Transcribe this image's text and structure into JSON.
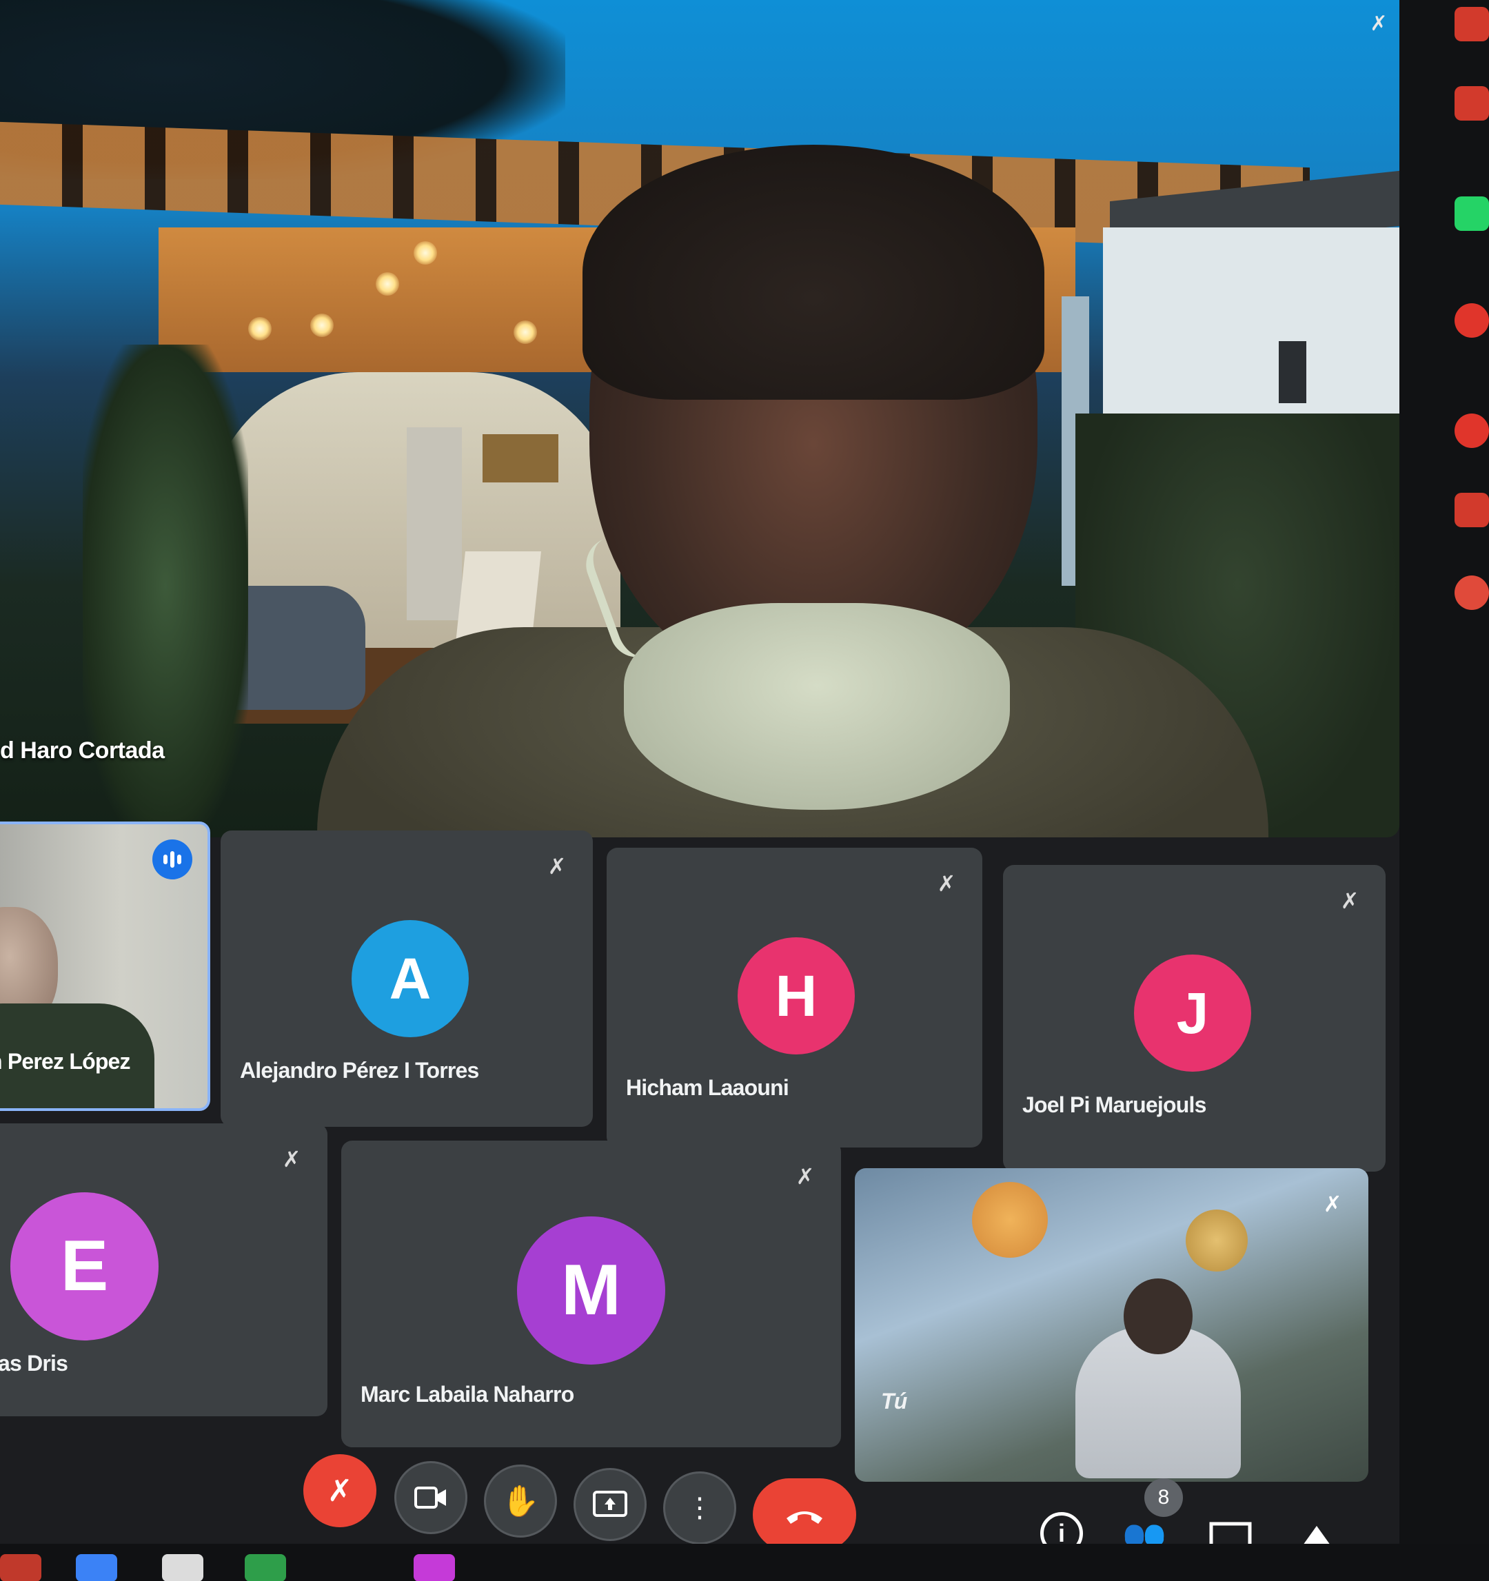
{
  "speaker": {
    "name": "d Haro Cortada",
    "mic_icon": "mic-off-icon"
  },
  "participants": [
    {
      "id": "jp",
      "name": "n Perez López",
      "initial": "",
      "speaking": true
    },
    {
      "id": "a",
      "name": "Alejandro Pérez I Torres",
      "initial": "A",
      "color": "#1e9fe0"
    },
    {
      "id": "h",
      "name": "Hicham Laaouni",
      "initial": "H",
      "color": "#e8336e"
    },
    {
      "id": "j",
      "name": "Joel Pi Maruejouls",
      "initial": "J",
      "color": "#e8336e"
    },
    {
      "id": "e",
      "name": "vas Dris",
      "initial": "E",
      "color": "#c955d8"
    },
    {
      "id": "m",
      "name": "Marc Labaila Naharro",
      "initial": "M",
      "color": "#a63fd2"
    },
    {
      "id": "you",
      "name": "Tú",
      "initial": ""
    }
  ],
  "controls": {
    "mic": "mic-off-icon",
    "camera": "camera-icon",
    "hand": "raise-hand-icon",
    "present": "present-screen-icon",
    "more": "more-options-icon",
    "leave": "end-call-icon"
  },
  "side_controls": {
    "info": "info-icon",
    "people_count": "8",
    "chat": "chat-icon",
    "activities": "activities-icon"
  },
  "colors": {
    "tile_bg": "#3c4043",
    "active_border": "#8ab4f8",
    "red": "#ea4335",
    "speaking_blue": "#1a73e8"
  }
}
